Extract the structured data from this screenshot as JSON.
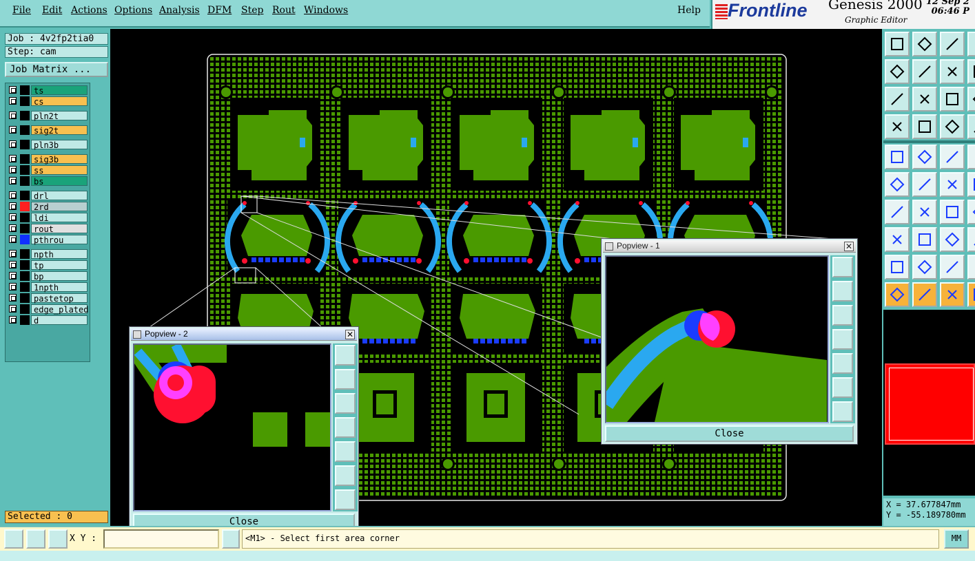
{
  "menu": {
    "items": [
      "File",
      "Edit",
      "Actions",
      "Options",
      "Analysis",
      "DFM",
      "Step",
      "Rout",
      "Windows"
    ],
    "help": "Help"
  },
  "brand": {
    "logo": "Frontline",
    "app": "Genesis 2000",
    "subtitle": "Graphic Editor",
    "date": "12 Sep 2",
    "time": "06:46 P"
  },
  "job": {
    "job": "Job : 4v2fp2tia0",
    "step": "Step: cam",
    "matrix_btn": "Job Matrix ..."
  },
  "layers": [
    {
      "name": "ts",
      "bg": "#1aa37a",
      "color": "#000"
    },
    {
      "name": "cs",
      "bg": "#f8c050",
      "color": "#000"
    },
    {
      "name": "pln2t",
      "bg": "#bfe9e6",
      "color": "#000"
    },
    {
      "name": "sig2t",
      "bg": "#f8c050",
      "color": "#000"
    },
    {
      "name": "pln3b",
      "bg": "#bfe9e6",
      "color": "#000"
    },
    {
      "name": "sig3b",
      "bg": "#f8c050",
      "color": "#000"
    },
    {
      "name": "ss",
      "bg": "#f8c050",
      "color": "#000"
    },
    {
      "name": "bs",
      "bg": "#1aa37a",
      "color": "#000"
    },
    {
      "name": "drl",
      "bg": "#bfe9e6",
      "color": "#000"
    },
    {
      "name": "2rd",
      "bg": "#b8cfd0",
      "color": "#ff2020"
    },
    {
      "name": "ldi",
      "bg": "#bfe9e6",
      "color": "#000"
    },
    {
      "name": "rout",
      "bg": "#e0e0e0",
      "color": "#000"
    },
    {
      "name": "pthrou",
      "bg": "#bfe9e6",
      "color": "#1030ff"
    },
    {
      "name": "npth",
      "bg": "#bfe9e6",
      "color": "#000"
    },
    {
      "name": "tp",
      "bg": "#bfe9e6",
      "color": "#000"
    },
    {
      "name": "bp",
      "bg": "#bfe9e6",
      "color": "#000"
    },
    {
      "name": "1npth",
      "bg": "#bfe9e6",
      "color": "#000"
    },
    {
      "name": "pastetop",
      "bg": "#bfe9e6",
      "color": "#000"
    },
    {
      "name": "edge_plated",
      "bg": "#bfe9e6",
      "color": "#000"
    },
    {
      "name": "d",
      "bg": "#bfe9e6",
      "color": "#000"
    }
  ],
  "selected": "Selected : 0",
  "coords": {
    "x": "X =  37.677847mm",
    "y": "Y = -55.189780mm"
  },
  "bottom": {
    "xy_label": "X Y :",
    "xy_value": "",
    "status": "<M1> - Select first area corner",
    "units": "MM"
  },
  "popview1": {
    "title": "Popview - 1",
    "close": "Close"
  },
  "popview2": {
    "title": "Popview - 2",
    "close": "Close"
  },
  "colors": {
    "board_green": "#4a9a00",
    "trace_blue": "#2aa8f0",
    "pad_red": "#ff1030",
    "pad_magenta": "#ff40ff",
    "accent": "#5fbfb9"
  }
}
